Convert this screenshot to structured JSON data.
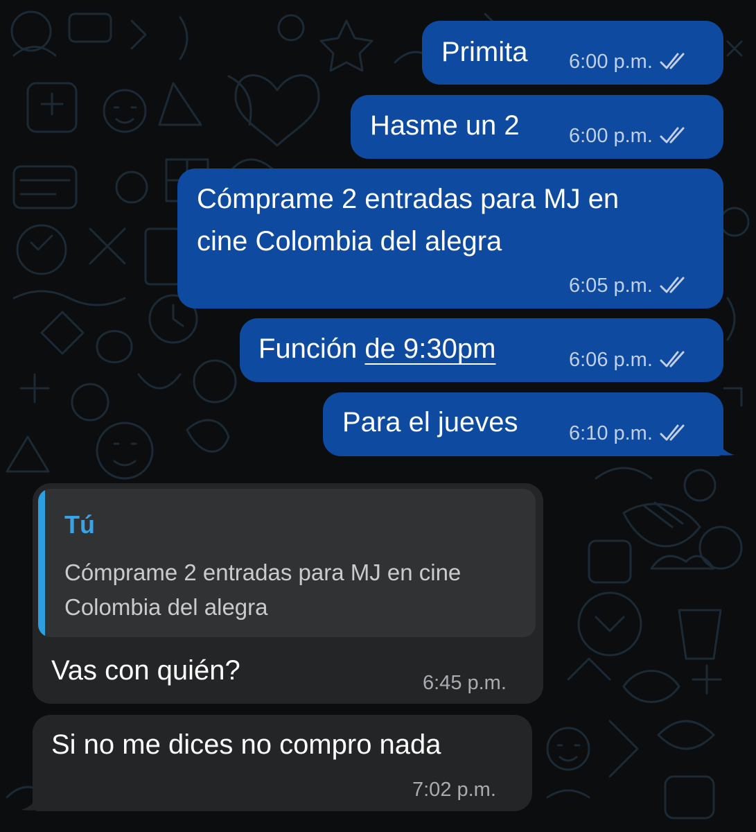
{
  "messages": [
    {
      "text": "Primita",
      "time": "6:00 p.m."
    },
    {
      "text": "Hasme un 2",
      "time": "6:00 p.m."
    },
    {
      "line1": "Cómprame 2 entradas para MJ en",
      "line2": "cine Colombia del alegra",
      "time": "6:05 p.m."
    },
    {
      "prefix": "Función ",
      "link": "de 9:30pm",
      "time": "6:06 p.m."
    },
    {
      "text": "Para el jueves",
      "time": "6:10 p.m."
    },
    {
      "quote": {
        "author": "Tú",
        "text": "Cómprame 2 entradas para MJ en cine Colombia del alegra"
      },
      "text": "Vas con quién?",
      "time": "6:45 p.m."
    },
    {
      "text": "Si no me dices no compro nada",
      "time": "7:02 p.m."
    }
  ],
  "icons": {
    "read_receipt": "double-check-icon"
  },
  "colors": {
    "background": "#0b0d0f",
    "outgoing_bubble": "#0d4aa0",
    "incoming_bubble": "#242526",
    "quote_accent": "#2b9fe0"
  }
}
